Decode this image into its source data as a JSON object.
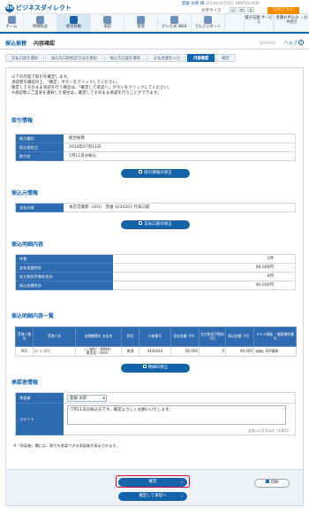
{
  "header": {
    "logo_mark": "Biz",
    "brand": "ビジネスダイレクト",
    "user_name": "愛銀 太郎 様",
    "user_meta": "2014年10月20日 09時50分00秒",
    "font_size_label": "文字サイズ",
    "font_small": "小",
    "font_medium": "中",
    "font_large": "大",
    "logout": "ログアウト"
  },
  "nav": {
    "items": [
      {
        "label": "ホーム"
      },
      {
        "label": "明細照会"
      },
      {
        "label": "資金移動"
      },
      {
        "label": "承認"
      },
      {
        "label": "管理"
      },
      {
        "label": "がいため WEB"
      },
      {
        "label": "でんさいネット"
      }
    ],
    "right": [
      {
        "label": "電子記録 サービス"
      },
      {
        "label": "各種お申込み ・お手続き"
      }
    ]
  },
  "title": {
    "category": "振込振替",
    "page": "内容確認",
    "screen_id": "BFKF024",
    "help": "ヘルプ",
    "help_icon": "?"
  },
  "steps": [
    "支払口座を選択",
    "振込先口座指定方法を選択",
    "振込先口座を選択",
    "支払金額を入力",
    "内容確認",
    "確定"
  ],
  "intro": [
    "以下の内容で取引を確定します。",
    "承認者を確認の上、「確定」ボタンをクリックしてください。",
    "確定してそのまま承認を行う場合は、「確定して承認へ」ボタンをクリックしてください。",
    "※承認者にご自身を選択した場合は、確定してそのまま承認を行うことができます。"
  ],
  "torihiki": {
    "heading": "取引情報",
    "rows": [
      {
        "k": "取引種別",
        "v": "総合振替"
      },
      {
        "k": "振込指定日",
        "v": "2014年07月11日"
      },
      {
        "k": "取引名",
        "v": "7月11日分振込"
      }
    ],
    "button": "取引情報の修正"
  },
  "source": {
    "heading": "振込元情報",
    "rows": [
      {
        "k": "支払口座",
        "v": "本店営業部（201） 普通 1234567 代表口座"
      }
    ],
    "button": "支払口座の修正"
  },
  "summary": {
    "heading": "振込明細内容",
    "rows": [
      {
        "k": "件数",
        "v": "1件"
      },
      {
        "k": "支払金額合計",
        "v": "90,000円"
      },
      {
        "k": "先方負担手数料合計",
        "v": "0円"
      },
      {
        "k": "振込金額合計",
        "v": "90,000円"
      }
    ]
  },
  "details": {
    "heading": "振込明細内容一覧",
    "columns": [
      "受取人番号",
      "受取人名",
      "金融機関名 支店名",
      "科目",
      "口座番号",
      "支払金額（円）",
      "先方負担手数料（円）",
      "振込金額（円）",
      "ＥＤＩ情報 ／顧客識別番号"
    ],
    "row": {
      "no": "001",
      "name": "ｴﾋﾞﾊﾞﾗ(ｶﾌﾞ",
      "bank": "○○銀行（9999）",
      "branch": "東支店（444）",
      "type": "普通",
      "account": "4444444",
      "pay": "90,000",
      "fee": "0",
      "amount": "90,000",
      "edi_tag": "EDI",
      "edi": "EDI情報"
    },
    "button": "明細の修正"
  },
  "approver": {
    "heading": "承認者情報",
    "approver_label": "承認者",
    "approver_value": "愛銀 太郎",
    "comment_label": "コメント",
    "comment": "7月11日分振込分です。確認よろしくお願いいたします。",
    "max_note": "全角120文字以内［半角可］"
  },
  "note": "※「承認者」欄には、取引を承認できる承認者が表示されます。",
  "actions": {
    "confirm": "確定",
    "confirm_approve": "確定して承認へ",
    "print": "印刷",
    "arrow": "›"
  },
  "colors": {
    "brand": "#1462a9",
    "header_cell": "#2e6bb0",
    "logout": "#f38a00",
    "highlight": "#d4003a"
  }
}
